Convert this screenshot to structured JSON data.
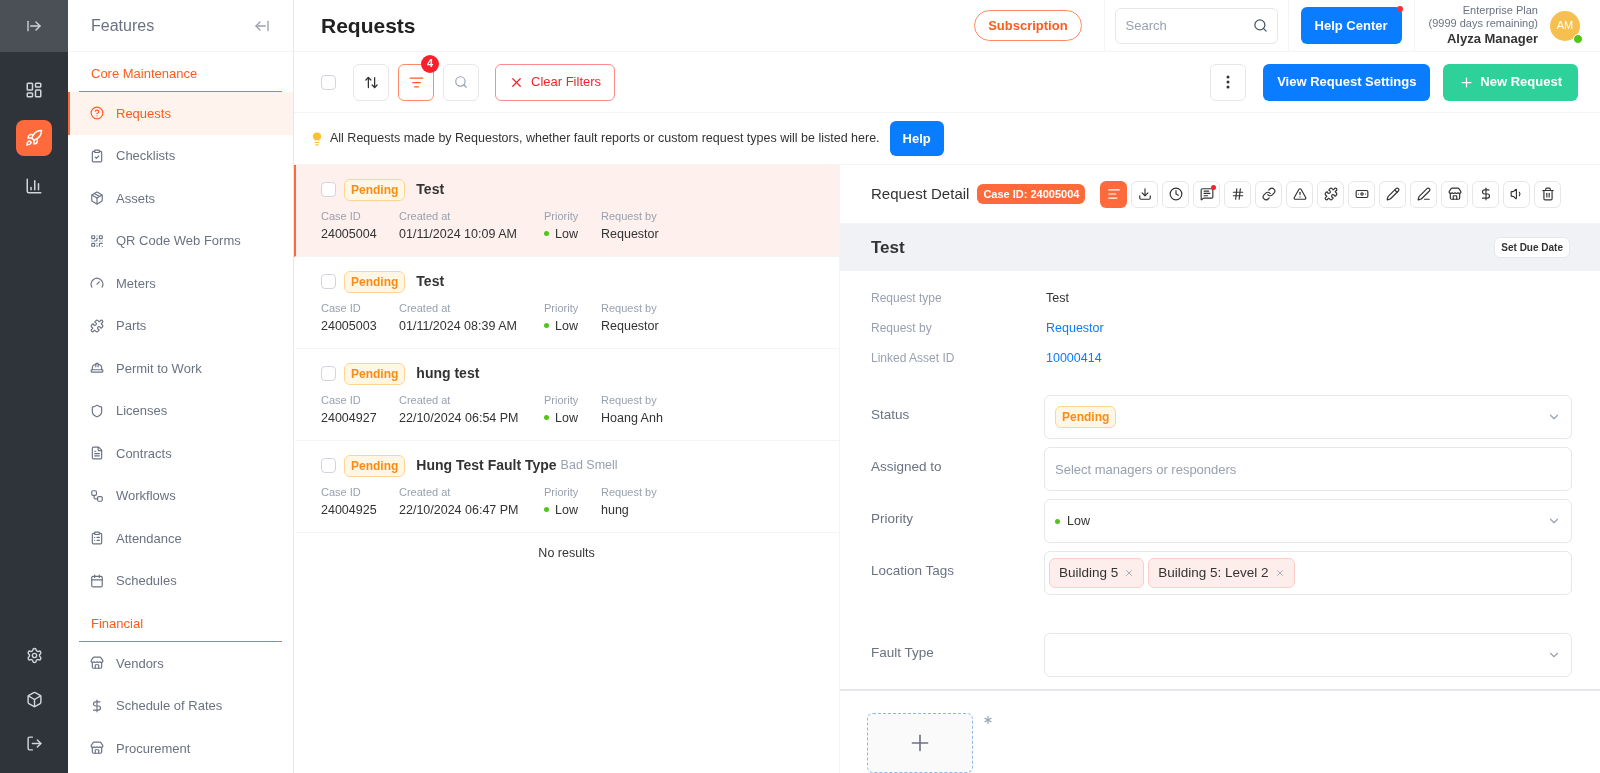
{
  "rail": {
    "items": [
      {
        "selected": false
      },
      {
        "selected": true
      },
      {
        "selected": false
      }
    ],
    "bottom_items": [
      {
        "selected": false
      },
      {
        "selected": false
      },
      {
        "selected": false
      }
    ]
  },
  "features": {
    "title": "Features",
    "sections": [
      {
        "title": "Core Maintenance",
        "items": [
          {
            "label": "Requests",
            "selected": true
          },
          {
            "label": "Checklists",
            "selected": false
          },
          {
            "label": "Assets",
            "selected": false
          },
          {
            "label": "QR Code Web Forms",
            "selected": false
          },
          {
            "label": "Meters",
            "selected": false
          },
          {
            "label": "Parts",
            "selected": false
          },
          {
            "label": "Permit to Work",
            "selected": false
          },
          {
            "label": "Licenses",
            "selected": false
          },
          {
            "label": "Contracts",
            "selected": false
          },
          {
            "label": "Workflows",
            "selected": false
          },
          {
            "label": "Attendance",
            "selected": false
          },
          {
            "label": "Schedules",
            "selected": false
          }
        ]
      },
      {
        "title": "Financial",
        "items": [
          {
            "label": "Vendors",
            "selected": false
          },
          {
            "label": "Schedule of Rates",
            "selected": false
          },
          {
            "label": "Procurement",
            "selected": false
          }
        ]
      }
    ]
  },
  "header": {
    "title": "Requests",
    "subscription": "Subscription",
    "search": {
      "placeholder": "Search"
    },
    "help_center": "Help Center",
    "plan": "Enterprise Plan",
    "plan_remaining": "(9999 days remaining)",
    "user_name": "Alyza Manager",
    "avatar_initials": "AM"
  },
  "toolbar": {
    "select_all_checked": false,
    "filter_count": "4",
    "clear_filters": "Clear Filters",
    "view_settings": "View Request Settings",
    "new_request": "New Request"
  },
  "info": {
    "text": "All Requests made by Requestors, whether fault reports or custom request types will be listed here.",
    "help": "Help"
  },
  "requests": [
    {
      "selected": true,
      "checked": false,
      "status": "Pending",
      "title": "Test",
      "case_id_label": "Case ID",
      "case_id": "24005004",
      "created_label": "Created at",
      "created": "01/11/2024 10:09 AM",
      "priority_label": "Priority",
      "priority": "Low",
      "by_label": "Request by",
      "by": "Requestor"
    },
    {
      "selected": false,
      "checked": false,
      "status": "Pending",
      "title": "Test",
      "case_id_label": "Case ID",
      "case_id": "24005003",
      "created_label": "Created at",
      "created": "01/11/2024 08:39 AM",
      "priority_label": "Priority",
      "priority": "Low",
      "by_label": "Request by",
      "by": "Requestor"
    },
    {
      "selected": false,
      "checked": false,
      "status": "Pending",
      "title": "hung test",
      "case_id_label": "Case ID",
      "case_id": "24004927",
      "created_label": "Created at",
      "created": "22/10/2024 06:54 PM",
      "priority_label": "Priority",
      "priority": "Low",
      "by_label": "Request by",
      "by": "Hoang Anh"
    },
    {
      "selected": false,
      "checked": false,
      "status": "Pending",
      "title": "Hung Test Fault Type",
      "subtitle": "Bad Smell",
      "case_id_label": "Case ID",
      "case_id": "24004925",
      "created_label": "Created at",
      "created": "22/10/2024 06:47 PM",
      "priority_label": "Priority",
      "priority": "Low",
      "by_label": "Request by",
      "by": "hung"
    }
  ],
  "no_results": "No results",
  "detail": {
    "title": "Request Detail",
    "case_badge": "Case ID: 24005004",
    "tools": [
      {
        "selected": true,
        "dot": false
      },
      {
        "selected": false,
        "dot": false
      },
      {
        "selected": false,
        "dot": false
      },
      {
        "selected": false,
        "dot": true
      },
      {
        "selected": false,
        "dot": false
      },
      {
        "selected": false,
        "dot": false
      },
      {
        "selected": false,
        "dot": false
      },
      {
        "selected": false,
        "dot": false
      },
      {
        "selected": false,
        "dot": false
      },
      {
        "selected": false,
        "dot": false
      },
      {
        "selected": false,
        "dot": false
      },
      {
        "selected": false,
        "dot": false
      },
      {
        "selected": false,
        "dot": false
      },
      {
        "selected": false,
        "dot": false
      },
      {
        "selected": false,
        "dot": false
      }
    ],
    "name": "Test",
    "set_due_date": "Set Due Date",
    "info_rows": [
      {
        "label": "Request type",
        "value": "Test",
        "link": false
      },
      {
        "label": "Request by",
        "value": "Requestor",
        "link": true
      },
      {
        "label": "Linked Asset ID",
        "value": "10000414",
        "link": true
      }
    ],
    "fields": [
      {
        "kind": "status",
        "label": "Status",
        "value": "Pending"
      },
      {
        "kind": "input",
        "label": "Assigned to",
        "placeholder": "Select managers or responders"
      },
      {
        "kind": "priority",
        "label": "Priority",
        "value": "Low"
      },
      {
        "kind": "tags",
        "label": "Location Tags",
        "tags": [
          "Building 5",
          "Building 5: Level 2"
        ]
      },
      {
        "kind": "select",
        "label": "Fault Type"
      }
    ]
  }
}
